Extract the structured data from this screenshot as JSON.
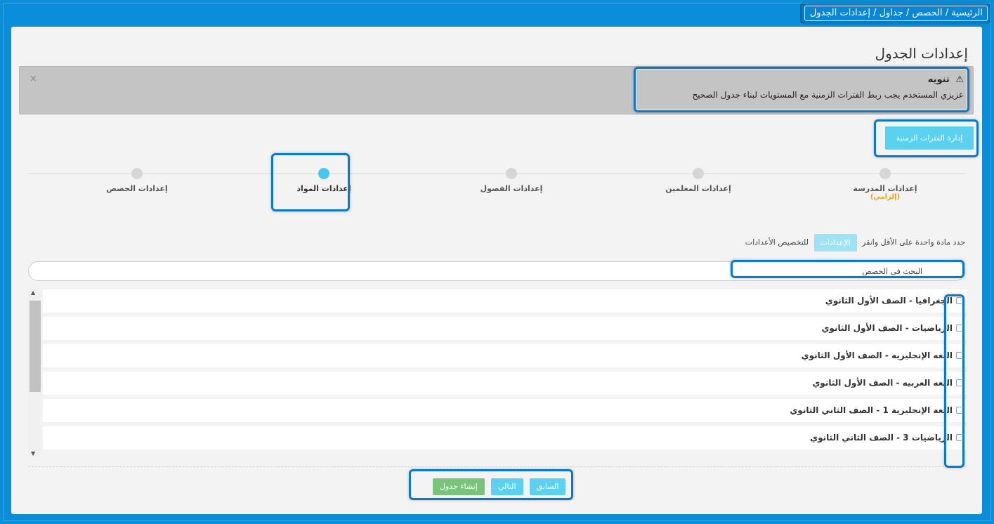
{
  "breadcrumb": {
    "text": "الرئيسية / الحصص / جداول / إعدادات الجدول"
  },
  "page": {
    "title": "إعدادات الجدول"
  },
  "alert": {
    "title": "تنويه",
    "message": "عزيزي المستخدم يجب ربط الفترات الزمنية مع المستويات لبناء جدول الصحيح",
    "close": "×"
  },
  "periods_button": {
    "label": "إدارة الفترات الزمنية"
  },
  "steps": [
    {
      "label": "إعدادات المدرسة",
      "note": "(إلزامي)"
    },
    {
      "label": "إعدادات المعلمين"
    },
    {
      "label": "إعدادات الفصول"
    },
    {
      "label": "إعدادات المواد"
    },
    {
      "label": "إعدادات الحصص"
    }
  ],
  "hint": {
    "before": "حدد مادة واحدة على الأقل وانقر",
    "chip": "الإعدادات",
    "after": "للتخصيص الأعدادات"
  },
  "search": {
    "placeholder": "البحث في الحصص"
  },
  "subjects": [
    "الجغرافيا - الصف الأول الثانوي",
    "الرياضيات - الصف الأول الثانوي",
    "اللغه الإنجليزيه - الصف الأول الثانوي",
    "اللغه العربيه - الصف الأول الثانوي",
    "اللغة الإنجليزية 1 - الصف الثاني الثانوي",
    "الرياضيات 3 - الصف الثاني الثانوي"
  ],
  "buttons": {
    "previous": "السابق",
    "next": "التالي",
    "create": "إنشاء جدول"
  },
  "icons": {
    "warning": "warning-icon",
    "close": "close-icon",
    "scroll_up": "arrow-up-icon",
    "scroll_down": "arrow-down-icon"
  },
  "colors": {
    "frame": "#0a8fd8",
    "accent": "#5bd0ef",
    "active_step": "#45c7ee",
    "create": "#78c47b",
    "required": "#e8a21c",
    "alert_bg": "#c4c4c4"
  }
}
